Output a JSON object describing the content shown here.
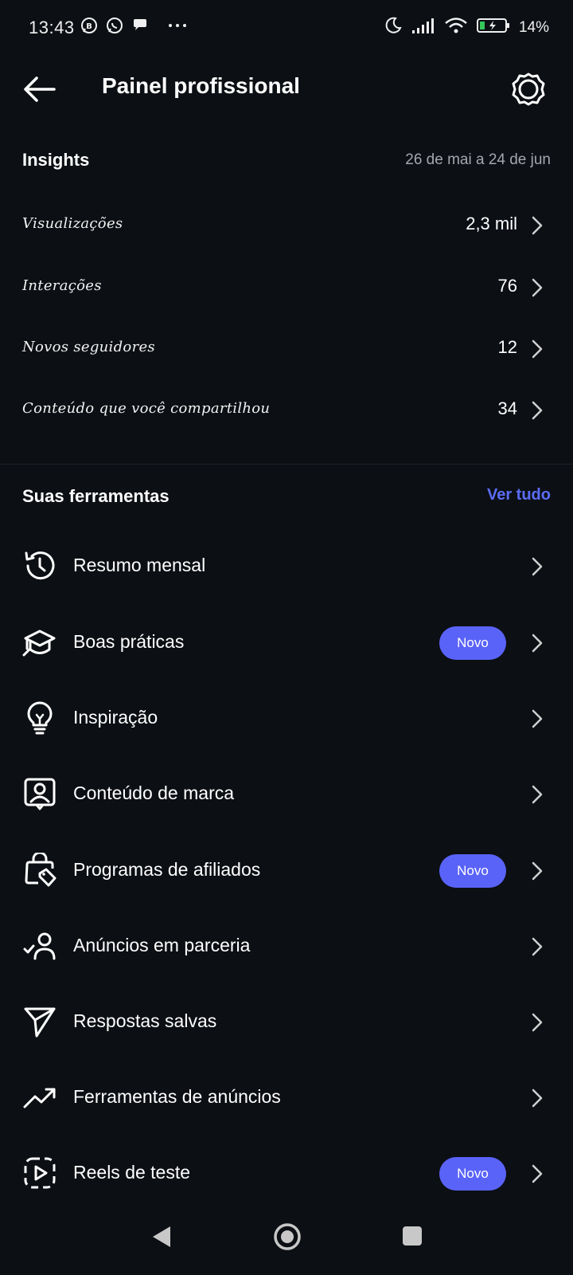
{
  "status_bar": {
    "time": "13:43",
    "battery": "14%",
    "icons": [
      "whatsapp-business-icon",
      "whatsapp-icon",
      "chat-icon",
      "more-dots-icon",
      "moon-icon",
      "signal-icon",
      "wifi-icon",
      "battery-charging-icon"
    ]
  },
  "header": {
    "title": "Painel profissional",
    "back_icon": "arrow-left-icon",
    "settings_icon": "gear-icon"
  },
  "insights": {
    "title": "Insights",
    "date_range": "26 de mai a 24 de jun",
    "rows": [
      {
        "label": "Visualizações",
        "value": "2,3 mil"
      },
      {
        "label": "Interações",
        "value": "76"
      },
      {
        "label": "Novos seguidores",
        "value": "12"
      },
      {
        "label": "Conteúdo que você compartilhou",
        "value": "34"
      }
    ]
  },
  "tools": {
    "title": "Suas ferramentas",
    "see_all": "Ver tudo",
    "items": [
      {
        "label": "Resumo mensal",
        "icon": "history-clock-icon",
        "badge": ""
      },
      {
        "label": "Boas práticas",
        "icon": "graduation-cap-icon",
        "badge": "Novo"
      },
      {
        "label": "Inspiração",
        "icon": "lightbulb-icon",
        "badge": ""
      },
      {
        "label": "Conteúdo de marca",
        "icon": "branded-content-icon",
        "badge": ""
      },
      {
        "label": "Programas de afiliados",
        "icon": "shopping-bag-tag-icon",
        "badge": "Novo"
      },
      {
        "label": "Anúncios em parceria",
        "icon": "user-check-icon",
        "badge": ""
      },
      {
        "label": "Respostas salvas",
        "icon": "send-icon",
        "badge": ""
      },
      {
        "label": "Ferramentas de anúncios",
        "icon": "trending-up-icon",
        "badge": ""
      },
      {
        "label": "Reels de teste",
        "icon": "reels-play-icon",
        "badge": "Novo"
      }
    ]
  },
  "colors": {
    "background": "#0c0f14",
    "accent": "#5b6df5",
    "badge": "#5a63f8",
    "text": "#ffffff",
    "muted": "#a4a7ad"
  }
}
